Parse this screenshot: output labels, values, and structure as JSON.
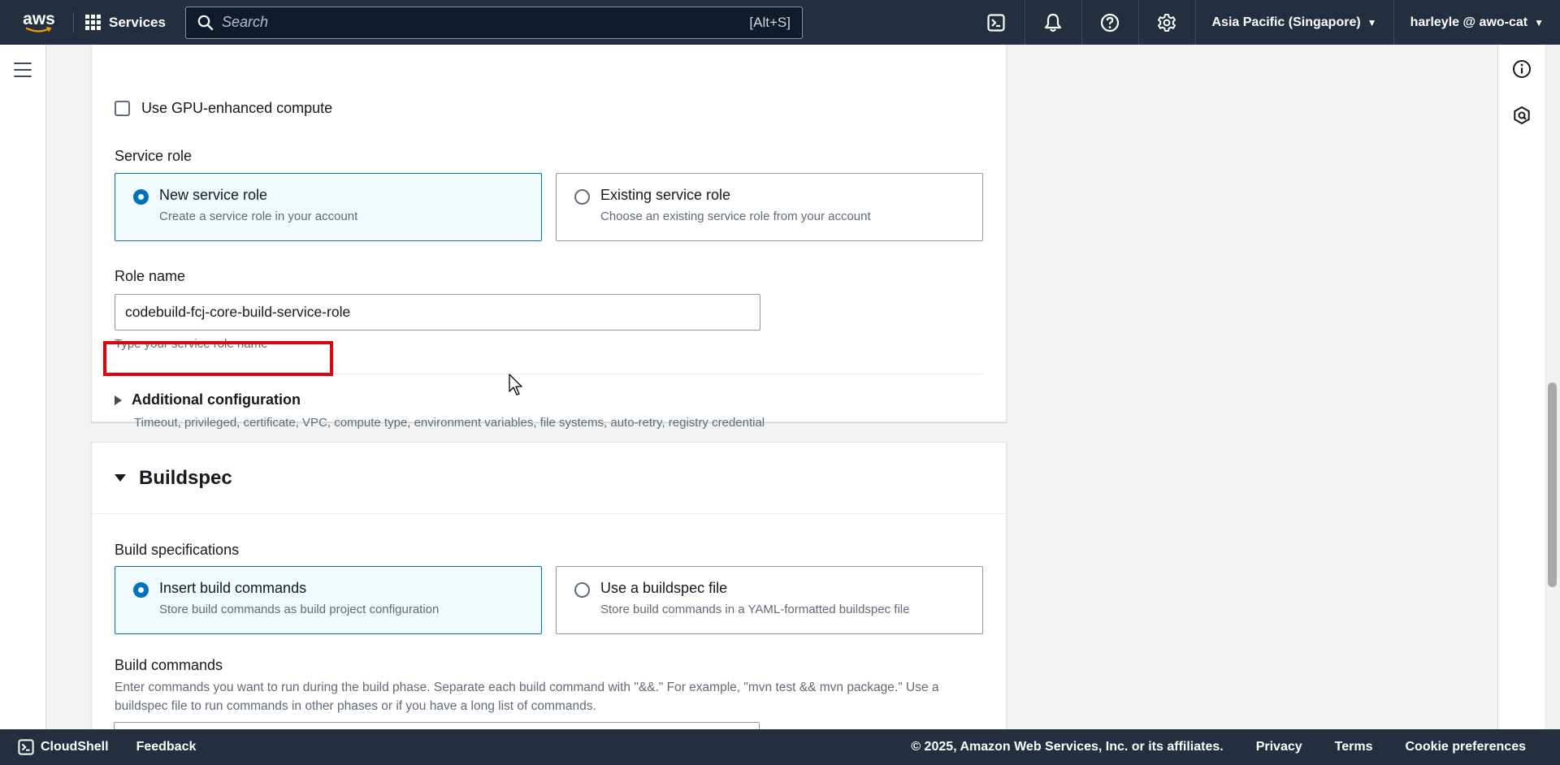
{
  "nav": {
    "logo_text": "aws",
    "services_label": "Services",
    "search_placeholder": "Search",
    "search_shortcut": "[Alt+S]",
    "region": "Asia Pacific (Singapore)",
    "account": "harleyle @ awo-cat",
    "icons": [
      "cloudshell-icon",
      "notifications-icon",
      "help-icon",
      "settings-icon"
    ]
  },
  "compute": {
    "gpu_checkbox_label": "Use GPU-enhanced compute",
    "gpu_checked": false
  },
  "service_role": {
    "label": "Service role",
    "options": [
      {
        "title": "New service role",
        "description": "Create a service role in your account",
        "selected": true
      },
      {
        "title": "Existing service role",
        "description": "Choose an existing service role from your account",
        "selected": false
      }
    ]
  },
  "role_name": {
    "label": "Role name",
    "value": "codebuild-fcj-core-build-service-role",
    "hint": "Type your service role name"
  },
  "additional_config": {
    "label": "Additional configuration",
    "description": "Timeout, privileged, certificate, VPC, compute type, environment variables, file systems, auto-retry, registry credential",
    "expanded": false,
    "highlighted": true
  },
  "buildspec": {
    "title": "Buildspec",
    "expanded": true,
    "spec_label": "Build specifications",
    "options": [
      {
        "title": "Insert build commands",
        "description": "Store build commands as build project configuration",
        "selected": true
      },
      {
        "title": "Use a buildspec file",
        "description": "Store build commands in a YAML-formatted buildspec file",
        "selected": false
      }
    ],
    "commands_label": "Build commands",
    "commands_description": "Enter commands you want to run during the build phase. Separate each build command with \"&&.\" For example, \"mvn test && mvn package.\" Use a buildspec file to run commands in other phases or if you have a long list of commands."
  },
  "footer": {
    "cloudshell": "CloudShell",
    "feedback": "Feedback",
    "copyright": "© 2025, Amazon Web Services, Inc. or its affiliates.",
    "privacy": "Privacy",
    "terms": "Terms",
    "cookies": "Cookie preferences"
  },
  "colors": {
    "nav_bg": "#232f3e",
    "accent": "#0073bb",
    "highlight_box": "#e0000b",
    "selected_tile_bg": "#f1faff"
  }
}
